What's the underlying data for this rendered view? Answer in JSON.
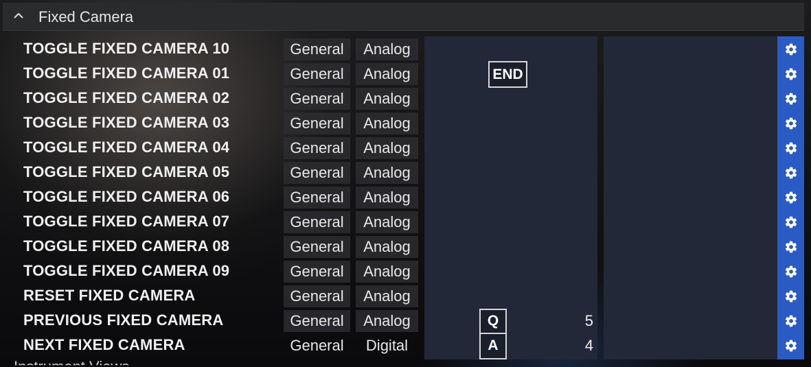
{
  "section": {
    "title": "Fixed Camera",
    "collapse_icon": "chevron-up-icon"
  },
  "rows": [
    {
      "name": "TOGGLE FIXED CAMERA 10",
      "category": "General",
      "type": "Analog"
    },
    {
      "name": "TOGGLE FIXED CAMERA 01",
      "category": "General",
      "type": "Analog",
      "binding": "END"
    },
    {
      "name": "TOGGLE FIXED CAMERA 02",
      "category": "General",
      "type": "Analog"
    },
    {
      "name": "TOGGLE FIXED CAMERA 03",
      "category": "General",
      "type": "Analog"
    },
    {
      "name": "TOGGLE FIXED CAMERA 04",
      "category": "General",
      "type": "Analog"
    },
    {
      "name": "TOGGLE FIXED CAMERA 05",
      "category": "General",
      "type": "Analog"
    },
    {
      "name": "TOGGLE FIXED CAMERA 06",
      "category": "General",
      "type": "Analog"
    },
    {
      "name": "TOGGLE FIXED CAMERA 07",
      "category": "General",
      "type": "Analog"
    },
    {
      "name": "TOGGLE FIXED CAMERA 08",
      "category": "General",
      "type": "Analog"
    },
    {
      "name": "TOGGLE FIXED CAMERA 09",
      "category": "General",
      "type": "Analog"
    },
    {
      "name": "RESET FIXED CAMERA",
      "category": "General",
      "type": "Analog"
    },
    {
      "name": "PREVIOUS FIXED CAMERA",
      "category": "General",
      "type": "Analog",
      "binding": "Q",
      "value": "5"
    },
    {
      "name": "NEXT FIXED CAMERA",
      "category": "General",
      "type": "Digital",
      "binding": "A",
      "value": "4"
    }
  ],
  "next_section_partial": "Instrument Views",
  "colors": {
    "accent": "#2a5bc4",
    "binding_bg": "#222838",
    "header_bg": "#2a2b2d"
  },
  "icons": {
    "settings": "gear-icon"
  }
}
